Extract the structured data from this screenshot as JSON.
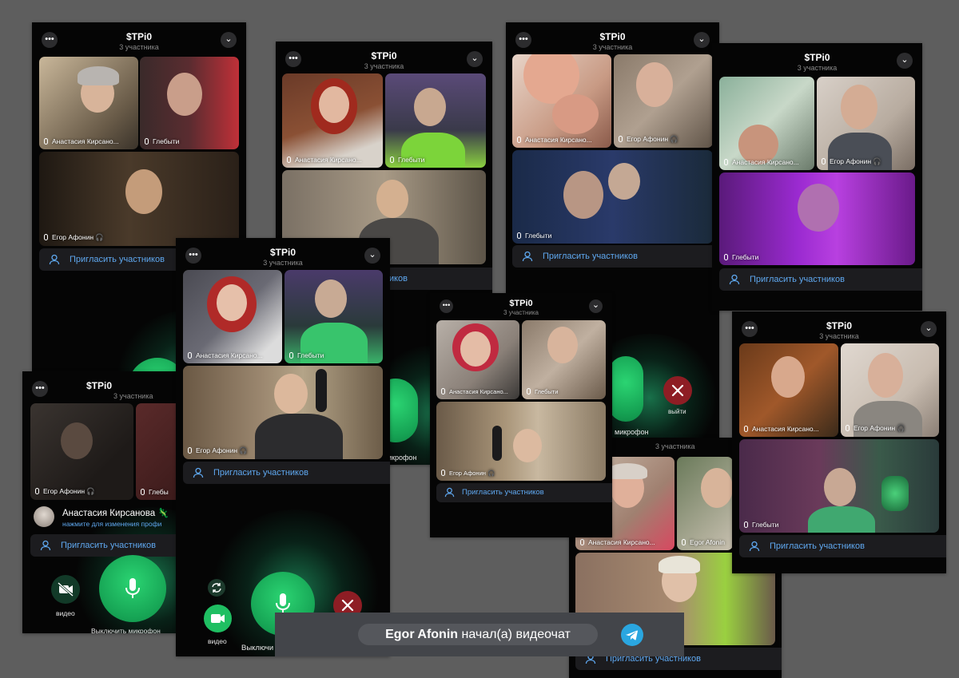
{
  "call_title": "$TPi0",
  "participants_count": "3 участника",
  "invite_label": "Пригласить участников",
  "users": {
    "anastasia_short": "Анастасия Кирсано...",
    "anastasia_full": "Анастасия Кирсанова 🦎",
    "egor": "Егор Афонин",
    "egor_latin": "Egor Afonin",
    "gleb": "Глебыти",
    "gleb_cut": "Глебы"
  },
  "profile_hint": "нажмите для изменения профи",
  "controls": {
    "video": "видео",
    "mic_off_a": "Выключить микрофон",
    "mic_off_b": "Выключи",
    "mic_c": "микрофон",
    "mic_d": "икрофон",
    "leave": "выйти"
  },
  "toast": {
    "name": "Egor Afonin",
    "action": "начал(а) видеочат"
  },
  "colors": {
    "accent_link": "#5fa8f0",
    "mic_green": "#1fbf62",
    "leave_red": "#8e1d24",
    "telegram_blue": "#2aa6e0"
  }
}
